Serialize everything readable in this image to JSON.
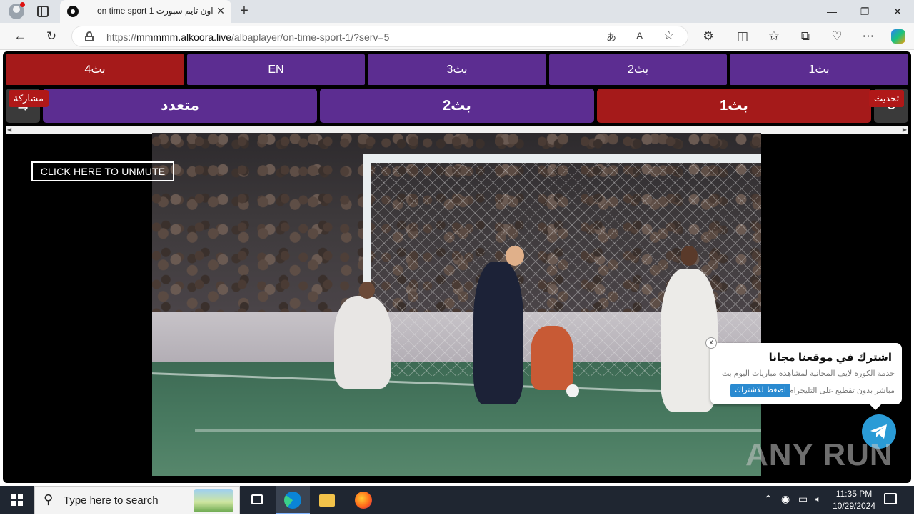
{
  "browser": {
    "tab_title": "on time sport 1 اون تايم سبورت",
    "tab_close": "✕",
    "new_tab": "+",
    "url_prefix": "https://",
    "url_host": "mmmmm.alkoora.live",
    "url_path": "/albaplayer/on-time-sport-1/?serv=5",
    "window_controls": {
      "minimize": "—",
      "maximize": "❐",
      "close": "✕"
    }
  },
  "servers": [
    {
      "label": "بث4",
      "active": true
    },
    {
      "label": "EN",
      "active": false
    },
    {
      "label": "بث3",
      "active": false
    },
    {
      "label": "بث2",
      "active": false
    },
    {
      "label": "بث1",
      "active": false
    }
  ],
  "streams": [
    {
      "label": "متعدد",
      "active": false
    },
    {
      "label": "بث2",
      "active": false
    },
    {
      "label": "بث1",
      "active": true
    }
  ],
  "share_label": "مشاركة",
  "refresh_label": "تحديث",
  "unmute_label": "CLICK HERE TO UNMUTE",
  "popup": {
    "title": "اشترك في موقعنا مجانا",
    "line1": "خدمة الكورة لايف المجانية لمشاهدة مباريات اليوم بث",
    "line2": "مباشر بدون تقطيع على التليجرام",
    "button": "اضغط للاشتراك",
    "close": "x"
  },
  "watermark": "ANY RUN",
  "taskbar": {
    "search_placeholder": "Type here to search",
    "time": "11:35 PM",
    "date": "10/29/2024"
  },
  "colors": {
    "server_purple": "#5c2d91",
    "active_red": "#a51a1a",
    "telegram_blue": "#2a9bd6"
  }
}
